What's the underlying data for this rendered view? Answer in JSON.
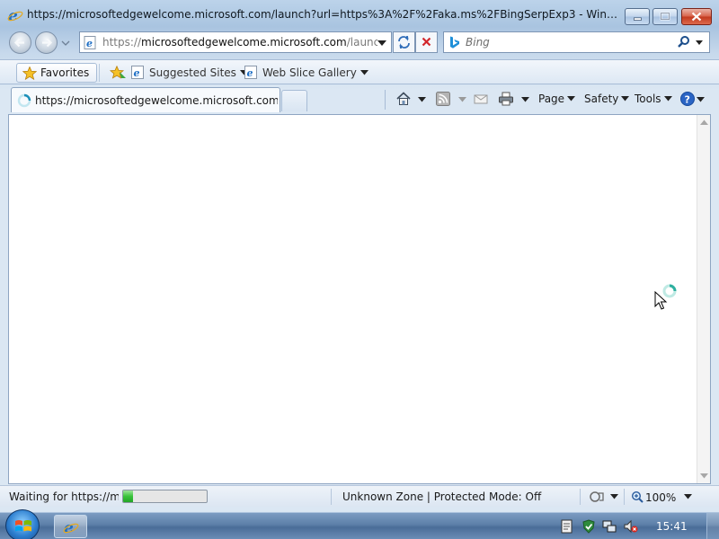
{
  "window": {
    "title": "https://microsoftedgewelcome.microsoft.com/launch?url=https%3A%2F%2Faka.ms%2FBingSerpExp3 - Windows Internet ..."
  },
  "address_bar": {
    "url_prefix": "https://",
    "url_host": "microsoftedgewelcome.microsoft.com",
    "url_path": "/launch?u"
  },
  "search": {
    "placeholder": "Bing"
  },
  "favorites_bar": {
    "favorites_label": "Favorites",
    "items": [
      {
        "label": "Suggested Sites"
      },
      {
        "label": "Web Slice Gallery"
      }
    ]
  },
  "tabs": [
    {
      "label": "https://microsoftedgewelcome.microsoft.com/la..."
    }
  ],
  "command_bar": {
    "page_label": "Page",
    "safety_label": "Safety",
    "tools_label": "Tools"
  },
  "status_bar": {
    "status_text": "Waiting for https://mic",
    "progress": 0.12,
    "zone_text": "Unknown Zone | Protected Mode: Off",
    "zoom": "100%"
  },
  "taskbar": {
    "clock": "15:41"
  },
  "colors": {
    "progress_green": "#38c33a",
    "close_button": "#c2391e",
    "ie_blue": "#1f6fc5"
  }
}
